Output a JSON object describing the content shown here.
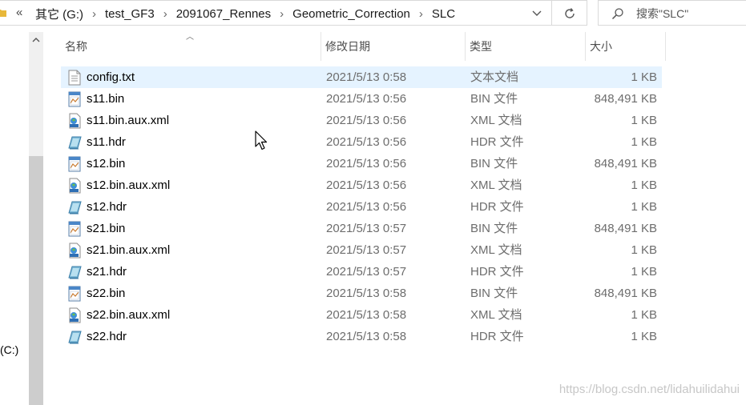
{
  "address": {
    "overflow": "«",
    "crumbs": [
      "其它 (G:)",
      "test_GF3",
      "2091067_Rennes",
      "Geometric_Correction",
      "SLC"
    ],
    "separator": "›"
  },
  "search": {
    "placeholder": "搜索\"SLC\""
  },
  "nav": {
    "drive_label": "(C:)"
  },
  "columns": {
    "name": "名称",
    "modified": "修改日期",
    "type": "类型",
    "size": "大小"
  },
  "files": [
    {
      "name": "config.txt",
      "modified": "2021/5/13 0:58",
      "type": "文本文档",
      "size": "1 KB",
      "icon": "text-file-icon",
      "selected": true
    },
    {
      "name": "s11.bin",
      "modified": "2021/5/13 0:56",
      "type": "BIN 文件",
      "size": "848,491 KB",
      "icon": "bin-file-icon"
    },
    {
      "name": "s11.bin.aux.xml",
      "modified": "2021/5/13 0:56",
      "type": "XML 文档",
      "size": "1 KB",
      "icon": "xml-file-icon"
    },
    {
      "name": "s11.hdr",
      "modified": "2021/5/13 0:56",
      "type": "HDR 文件",
      "size": "1 KB",
      "icon": "hdr-file-icon"
    },
    {
      "name": "s12.bin",
      "modified": "2021/5/13 0:56",
      "type": "BIN 文件",
      "size": "848,491 KB",
      "icon": "bin-file-icon"
    },
    {
      "name": "s12.bin.aux.xml",
      "modified": "2021/5/13 0:56",
      "type": "XML 文档",
      "size": "1 KB",
      "icon": "xml-file-icon"
    },
    {
      "name": "s12.hdr",
      "modified": "2021/5/13 0:56",
      "type": "HDR 文件",
      "size": "1 KB",
      "icon": "hdr-file-icon"
    },
    {
      "name": "s21.bin",
      "modified": "2021/5/13 0:57",
      "type": "BIN 文件",
      "size": "848,491 KB",
      "icon": "bin-file-icon"
    },
    {
      "name": "s21.bin.aux.xml",
      "modified": "2021/5/13 0:57",
      "type": "XML 文档",
      "size": "1 KB",
      "icon": "xml-file-icon"
    },
    {
      "name": "s21.hdr",
      "modified": "2021/5/13 0:57",
      "type": "HDR 文件",
      "size": "1 KB",
      "icon": "hdr-file-icon"
    },
    {
      "name": "s22.bin",
      "modified": "2021/5/13 0:58",
      "type": "BIN 文件",
      "size": "848,491 KB",
      "icon": "bin-file-icon"
    },
    {
      "name": "s22.bin.aux.xml",
      "modified": "2021/5/13 0:58",
      "type": "XML 文档",
      "size": "1 KB",
      "icon": "xml-file-icon"
    },
    {
      "name": "s22.hdr",
      "modified": "2021/5/13 0:58",
      "type": "HDR 文件",
      "size": "1 KB",
      "icon": "hdr-file-icon"
    }
  ],
  "watermark": "https://blog.csdn.net/lidahuilidahui",
  "colors": {
    "selected_row": "#e5f3ff",
    "secondary_text": "#6d6d6d",
    "border": "#d9d9d9"
  }
}
